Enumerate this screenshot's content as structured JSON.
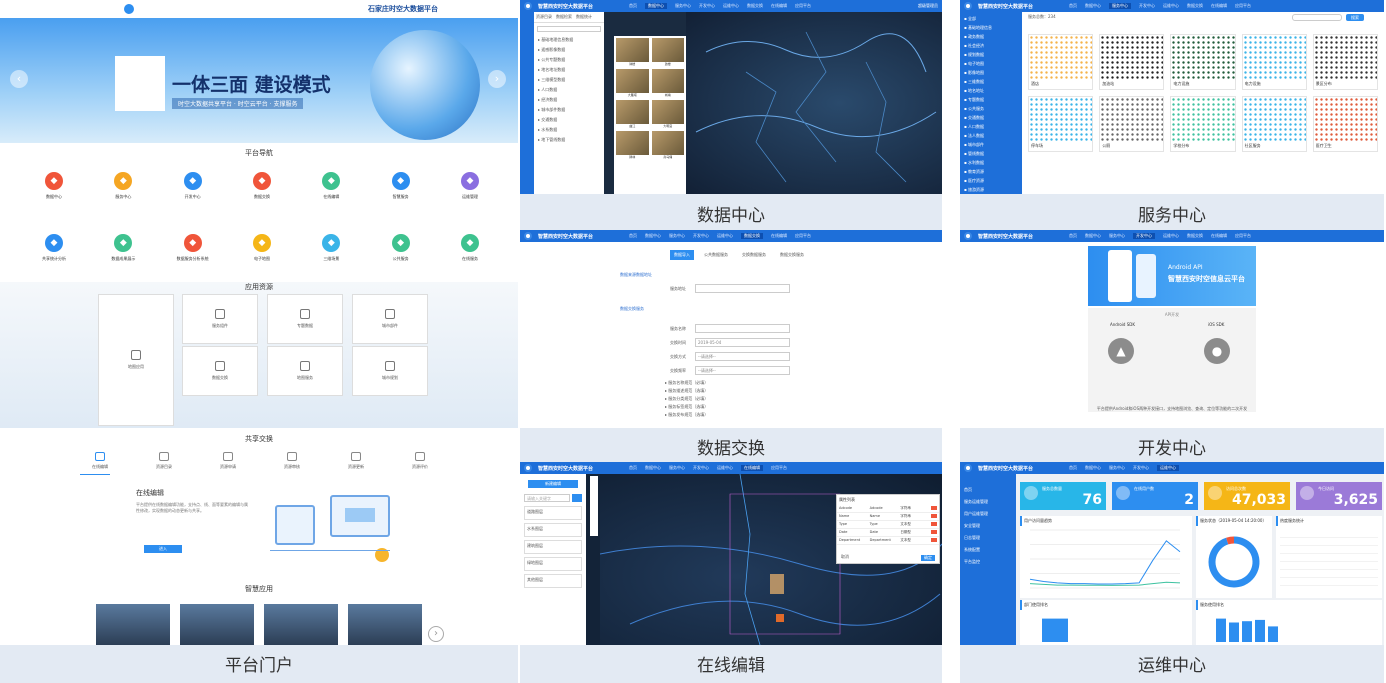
{
  "captions": {
    "portal": "平台门户",
    "data_center": "数据中心",
    "service_center": "服务中心",
    "data_exchange": "数据交换",
    "dev_center": "开发中心",
    "online_edit": "在线编辑",
    "ops_center": "运维中心"
  },
  "portal": {
    "header_title": "石家庄时空大数据平台",
    "hero_title": "一体三面  建设模式",
    "hero_sub": "时空大数据共享平台 · 时空云平台 · 支撑服务",
    "nav_heading": "平台导航",
    "nav_row1": [
      "数据中心",
      "服务中心",
      "开发中心",
      "数据交换",
      "在线编辑",
      "智慧服务",
      "运维管理"
    ],
    "nav_row2": [
      "共享统计分析",
      "数据成果展示",
      "数据服务分析系统",
      "电子地图",
      "三维场景",
      "公共服务",
      "在线服务"
    ],
    "app_heading": "应用资源",
    "app_tiles": [
      "地图应用",
      "服务组件",
      "专题数据",
      "城市部件",
      "数据交换",
      "地图服务",
      "城市规划"
    ],
    "share_heading": "共享交换",
    "share_tabs": [
      "在线编辑",
      "资源目录",
      "资源申请",
      "资源审核",
      "资源更新",
      "资源评价"
    ],
    "share_title": "在线编辑",
    "share_desc": "平台提供在线数据编辑功能，支持点、线、面等要素的编辑与属性修改，实现数据的动态更新与共享。",
    "share_button": "进入",
    "smart_heading": "智慧应用"
  },
  "data_center": {
    "app_title": "智慧西安时空大数据平台",
    "nav": [
      "首页",
      "数据中心",
      "服务中心",
      "开发中心",
      "运维中心",
      "数据交换",
      "在线编辑",
      "应用平台"
    ],
    "active_nav": "数据中心",
    "user": "超级管理员",
    "side_tabs": [
      "资源目录",
      "数据检索",
      "数据统计"
    ],
    "tree_items": [
      "基础地理信息数据",
      "遥感影像数据",
      "公共专题数据",
      "地名地址数据",
      "三维模型数据",
      "人口数据",
      "经济数据",
      "城市部件数据",
      "交通数据",
      "水系数据",
      "地下管线数据"
    ],
    "thumb_labels": [
      "钟楼",
      "鼓楼",
      "大雁塔",
      "城墙",
      "曲江",
      "大明宫",
      "碑林",
      "兵马俑"
    ]
  },
  "service_center": {
    "app_title": "智慧西安时空大数据平台",
    "nav": [
      "首页",
      "数据中心",
      "服务中心",
      "开发中心",
      "运维中心",
      "数据交换",
      "在线编辑",
      "应用平台"
    ],
    "active_nav": "服务中心",
    "filter": "服务总数：234",
    "search_btn": "搜索",
    "sidebar_items": [
      "全部",
      "基础地理信息",
      "政务数据",
      "社会经济",
      "规划数据",
      "电子地图",
      "影像地图",
      "三维数据",
      "地名地址",
      "专题数据",
      "公共服务",
      "交通数据",
      "人口数据",
      "法人数据",
      "城市部件",
      "管线数据",
      "水利数据",
      "教育资源",
      "医疗资源",
      "旅游资源"
    ],
    "cards": [
      "酒店",
      "加油站",
      "电力设施",
      "电力设施",
      "景区分布",
      "停车场",
      "公厕",
      "学校分布",
      "社区服务",
      "医疗卫生"
    ]
  },
  "data_exchange": {
    "app_title": "智慧西安时空大数据平台",
    "nav": [
      "首页",
      "数据中心",
      "服务中心",
      "开发中心",
      "运维中心",
      "数据交换",
      "在线编辑",
      "应用平台"
    ],
    "active_nav": "数据交换",
    "tabs": [
      "数据导入",
      "公共数据服务",
      "交换数据服务",
      "数据交换服务"
    ],
    "section1": "数据来源数据地址",
    "field_url": "服务地址",
    "section2": "数据交换服务",
    "fields": [
      "服务名称",
      "交换时间",
      "交换方式",
      "交换频率"
    ],
    "date_value": "2019-05-04",
    "select_placeholder": "--请选择--",
    "list": [
      "服务名称规范（必填）",
      "服务描述规范（选填）",
      "服务分类规范（必填）",
      "服务标签规范（选填）",
      "服务发布规范（选填）"
    ]
  },
  "dev_center": {
    "app_title": "智慧西安时空大数据平台",
    "nav": [
      "首页",
      "数据中心",
      "服务中心",
      "开发中心",
      "运维中心",
      "数据交换",
      "在线编辑",
      "应用平台"
    ],
    "active_nav": "开发中心",
    "banner_title": "Android API",
    "banner_sub": "智慧西安时空信息云平台",
    "section": "API开发",
    "sdk_android": "Android SDK",
    "sdk_ios": "iOS SDK",
    "note": "平台提供Android和iOS两种开发接口，支持地图浏览、查询、定位等功能的二次开发"
  },
  "online_edit": {
    "app_title": "智慧西安时空大数据平台",
    "nav": [
      "首页",
      "数据中心",
      "服务中心",
      "开发中心",
      "运维中心",
      "在线编辑",
      "应用平台"
    ],
    "active_nav": "在线编辑",
    "new_btn": "新建编辑",
    "search_placeholder": "请输入关键字",
    "list_items": [
      "道路图层",
      "水系图层",
      "建筑图层",
      "绿地图层",
      "其他图层"
    ],
    "dialog_title": "属性列表",
    "dialog_rows": [
      [
        "Adcode",
        "Adcode",
        "字符串"
      ],
      [
        "Name",
        "Name",
        "字符串"
      ],
      [
        "Type",
        "Type",
        "文本型"
      ],
      [
        "Date",
        "Date",
        "日期型"
      ],
      [
        "Department",
        "Department",
        "文本型"
      ]
    ],
    "dialog_cancel": "取消",
    "dialog_ok": "确定"
  },
  "ops_center": {
    "app_title": "智慧西安时空大数据平台",
    "nav": [
      "首页",
      "数据中心",
      "服务中心",
      "开发中心",
      "运维中心"
    ],
    "active_nav": "运维中心",
    "sidebar": [
      "首页",
      "服务运维管理",
      "用户运维管理",
      "安全管理",
      "日志管理",
      "系统配置",
      "平台监控"
    ],
    "stats": [
      {
        "label": "服务总数量",
        "value": "76",
        "color": "#28b6e8"
      },
      {
        "label": "在线用户数",
        "value": "2",
        "color": "#2d8ef0"
      },
      {
        "label": "访问总次数",
        "value": "47,033",
        "color": "#f5b617"
      },
      {
        "label": "今日访问",
        "value": "3,625",
        "color": "#9b7ad8"
      }
    ],
    "chart1_title": "用户访问量趋势",
    "chart2_title": "服务状态（2019-05-04 14:20:00）",
    "chart3_title": "热度服务统计",
    "chart4_title": "部门使用排名",
    "chart5_title": "服务使用排名",
    "toggle": [
      "日",
      "周",
      "月"
    ]
  },
  "chart_data": [
    {
      "type": "line",
      "title": "用户访问量趋势",
      "x": [
        "1",
        "2",
        "3",
        "4",
        "5",
        "6",
        "7",
        "8",
        "9",
        "10",
        "11",
        "12"
      ],
      "series": [
        {
          "values": [
            120,
            90,
            70,
            60,
            60,
            55,
            55,
            60,
            70,
            380,
            650,
            500
          ]
        },
        {
          "values": [
            60,
            50,
            40,
            40,
            38,
            38,
            36,
            38,
            40,
            60,
            80,
            70
          ]
        }
      ],
      "ylim": [
        0,
        800
      ]
    },
    {
      "type": "pie",
      "title": "服务状态（2019-05-04 14:20:00）",
      "values": [
        95,
        5
      ],
      "colors": [
        "#2d8ef0",
        "#f0553a"
      ]
    },
    {
      "type": "bar",
      "title": "部门使用排名",
      "values": [
        90
      ]
    },
    {
      "type": "bar",
      "title": "服务使用排名",
      "values": [
        90,
        75,
        80,
        85,
        60
      ]
    }
  ]
}
